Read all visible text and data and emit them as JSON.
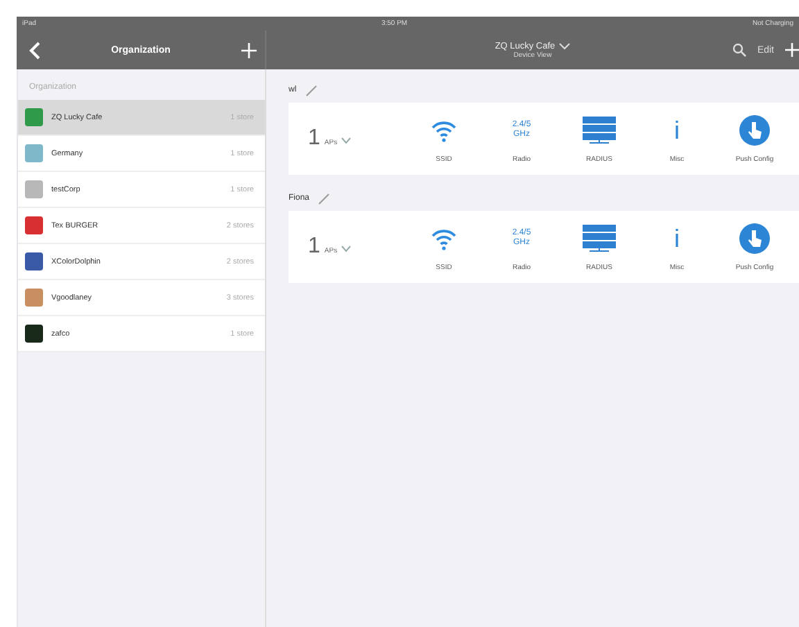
{
  "status_bar": {
    "carrier": "iPad",
    "time": "3:50 PM",
    "battery": "Not Charging"
  },
  "left_nav": {
    "title": "Organization"
  },
  "main_nav": {
    "title": "ZQ Lucky Cafe",
    "subtitle": "Device View",
    "edit": "Edit"
  },
  "organizations": {
    "heading": "Organization",
    "items": [
      {
        "name": "ZQ Lucky Cafe",
        "stores": "1 store",
        "color": "#2e9a4a",
        "selected": true
      },
      {
        "name": "Germany",
        "stores": "1 store",
        "color": "#7fb8c8",
        "selected": false
      },
      {
        "name": "testCorp",
        "stores": "1 store",
        "color": "#b8b8b8",
        "selected": false
      },
      {
        "name": "Tex BURGER",
        "stores": "2 stores",
        "color": "#d83030",
        "selected": false
      },
      {
        "name": "XColorDolphin",
        "stores": "2 stores",
        "color": "#3a5aa8",
        "selected": false
      },
      {
        "name": "Vgoodlaney",
        "stores": "3 stores",
        "color": "#c89060",
        "selected": false
      },
      {
        "name": "zafco",
        "stores": "1 store",
        "color": "#1a2a1a",
        "selected": false
      }
    ]
  },
  "groups": [
    {
      "name": "wl",
      "count": "1",
      "unit": "APs",
      "tiles": [
        {
          "kind": "wifi",
          "label": "SSID"
        },
        {
          "kind": "radio",
          "label": "Radio",
          "text": "2.4/5 GHz"
        },
        {
          "kind": "server",
          "label": "RADIUS"
        },
        {
          "kind": "info",
          "label": "Misc",
          "text": "i"
        },
        {
          "kind": "push",
          "label": "Push Config"
        }
      ]
    },
    {
      "name": "Fiona",
      "count": "1",
      "unit": "APs",
      "tiles": [
        {
          "kind": "wifi",
          "label": "SSID"
        },
        {
          "kind": "radio",
          "label": "Radio",
          "text": "2.4/5 GHz"
        },
        {
          "kind": "server",
          "label": "RADIUS"
        },
        {
          "kind": "info",
          "label": "Misc",
          "text": "i"
        },
        {
          "kind": "push",
          "label": "Push Config"
        }
      ]
    }
  ]
}
